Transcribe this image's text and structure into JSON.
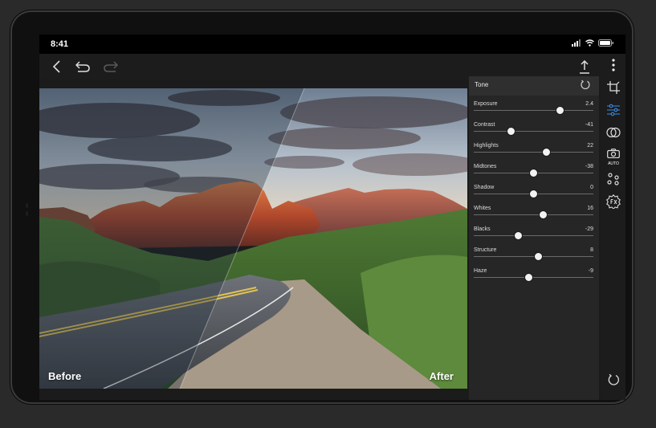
{
  "status_bar": {
    "time": "8:41"
  },
  "toolbar": {
    "back": "back-arrow-icon",
    "undo": "undo-icon",
    "redo": "redo-icon",
    "share": "share-icon",
    "more": "more-vertical-icon"
  },
  "photo": {
    "before_label": "Before",
    "after_label": "After"
  },
  "panel": {
    "title": "Tone",
    "sliders": [
      {
        "label": "Exposure",
        "value": "2.4",
        "level": 0.72
      },
      {
        "label": "Contrast",
        "value": "-41",
        "level": 0.31
      },
      {
        "label": "Highlights",
        "value": "22",
        "level": 0.61
      },
      {
        "label": "Midtones",
        "value": "-38",
        "level": 0.5
      },
      {
        "label": "Shadow",
        "value": "0",
        "level": 0.5
      },
      {
        "label": "Whites",
        "value": "16",
        "level": 0.58
      },
      {
        "label": "Blacks",
        "value": "-29",
        "level": 0.37
      },
      {
        "label": "Structure",
        "value": "8",
        "level": 0.54
      },
      {
        "label": "Haze",
        "value": "-9",
        "level": 0.46
      }
    ]
  },
  "rail": {
    "auto_label": "AUTO",
    "accent_color": "#3a8ee6"
  }
}
